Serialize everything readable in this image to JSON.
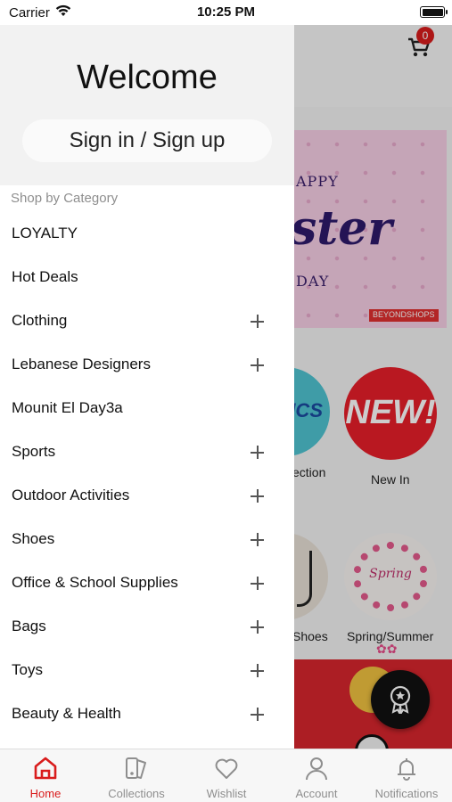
{
  "status_bar": {
    "carrier": "Carrier",
    "time": "10:25 PM"
  },
  "drawer": {
    "welcome": "Welcome",
    "signin_label": "Sign in / Sign up",
    "category_title": "Shop by Category",
    "items": [
      {
        "label": "LOYALTY",
        "expandable": false
      },
      {
        "label": "Hot Deals",
        "expandable": false
      },
      {
        "label": "Clothing",
        "expandable": true
      },
      {
        "label": "Lebanese Designers",
        "expandable": true
      },
      {
        "label": "Mounit El Day3a",
        "expandable": false
      },
      {
        "label": "Sports",
        "expandable": true
      },
      {
        "label": "Outdoor Activities",
        "expandable": true
      },
      {
        "label": "Shoes",
        "expandable": true
      },
      {
        "label": "Office & School Supplies",
        "expandable": true
      },
      {
        "label": "Bags",
        "expandable": true
      },
      {
        "label": "Toys",
        "expandable": true
      },
      {
        "label": "Beauty & Health",
        "expandable": true
      }
    ]
  },
  "main": {
    "cart_count": "0",
    "banner": {
      "top": "APPY",
      "main": "ster",
      "bottom": "DAY",
      "logo": "BEYONDSHOPS"
    },
    "collections": [
      {
        "label": "ection",
        "image_text": "ICS"
      },
      {
        "label": "New In",
        "image_text": "NEW!"
      },
      {
        "label": "Shoes"
      },
      {
        "label": "Spring/Summer",
        "image_text": "Spring"
      }
    ]
  },
  "tabs": [
    {
      "label": "Home",
      "icon": "home-icon",
      "active": true
    },
    {
      "label": "Collections",
      "icon": "collections-icon",
      "active": false
    },
    {
      "label": "Wishlist",
      "icon": "heart-icon",
      "active": false
    },
    {
      "label": "Account",
      "icon": "account-icon",
      "active": false
    },
    {
      "label": "Notifications",
      "icon": "bell-icon",
      "active": false
    }
  ],
  "colors": {
    "accent": "#d91c1c",
    "drawer_header": "#f2f2f2",
    "tab_inactive": "#8e8e8e"
  }
}
